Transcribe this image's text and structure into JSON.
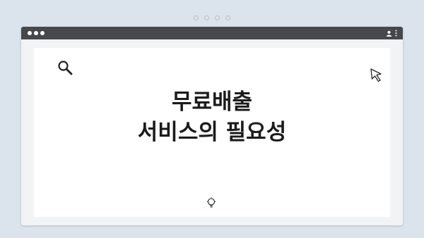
{
  "slide": {
    "title_line1": "무료배출",
    "title_line2": "서비스의 필요성"
  },
  "icons": {
    "search": "search-icon",
    "cursor": "cursor-icon",
    "lightbulb": "lightbulb-icon",
    "user": "user-icon",
    "menu": "kebab-menu-icon"
  },
  "colors": {
    "background": "#dbe4ec",
    "titlebar": "#47484b",
    "window": "#f2f3f5",
    "content": "#ffffff",
    "text": "#1b1b1b"
  }
}
